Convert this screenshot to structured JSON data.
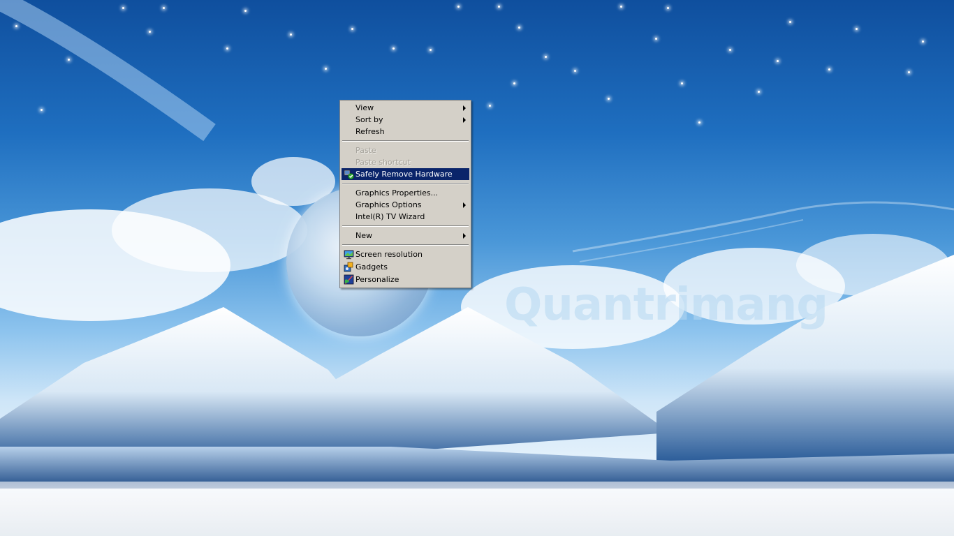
{
  "desktop": {
    "watermark": "Quantrimang"
  },
  "context_menu": {
    "items": [
      {
        "label": "View",
        "submenu": true,
        "enabled": true
      },
      {
        "label": "Sort by",
        "submenu": true,
        "enabled": true
      },
      {
        "label": "Refresh",
        "submenu": false,
        "enabled": true
      },
      {
        "label": "Paste",
        "submenu": false,
        "enabled": false
      },
      {
        "label": "Paste shortcut",
        "submenu": false,
        "enabled": false
      },
      {
        "label": "Safely Remove Hardware",
        "submenu": false,
        "enabled": true,
        "highlighted": true,
        "icon": "usb-remove-icon"
      },
      {
        "label": "Graphics Properties...",
        "submenu": false,
        "enabled": true
      },
      {
        "label": "Graphics Options",
        "submenu": true,
        "enabled": true
      },
      {
        "label": "Intel(R) TV Wizard",
        "submenu": false,
        "enabled": true
      },
      {
        "label": "New",
        "submenu": true,
        "enabled": true
      },
      {
        "label": "Screen resolution",
        "submenu": false,
        "enabled": true,
        "icon": "monitor-icon"
      },
      {
        "label": "Gadgets",
        "submenu": false,
        "enabled": true,
        "icon": "gadgets-icon"
      },
      {
        "label": "Personalize",
        "submenu": false,
        "enabled": true,
        "icon": "personalize-icon"
      }
    ],
    "colors": {
      "background": "#d4d0c8",
      "highlight": "#0a246a",
      "highlight_text": "#ffffff",
      "disabled_text": "#a6a39c"
    }
  }
}
